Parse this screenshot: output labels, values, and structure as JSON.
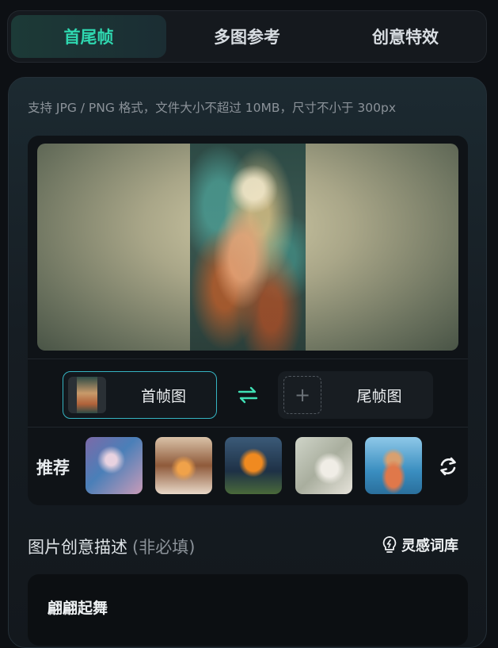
{
  "tabs": [
    {
      "label": "首尾帧",
      "active": true
    },
    {
      "label": "多图参考",
      "active": false
    },
    {
      "label": "创意特效",
      "active": false
    }
  ],
  "upload": {
    "hint": "支持 JPG / PNG 格式，文件大小不超过 10MB，尺寸不小于 300px",
    "first_frame_label": "首帧图",
    "last_frame_label": "尾帧图"
  },
  "recommend": {
    "label": "推荐",
    "items": [
      {
        "icon": "underwater-girl-thumbnail"
      },
      {
        "icon": "snow-cabin-thumbnail"
      },
      {
        "icon": "pumpkin-house-thumbnail"
      },
      {
        "icon": "girl-with-cat-thumbnail"
      },
      {
        "icon": "hamster-float-thumbnail"
      }
    ]
  },
  "description": {
    "title": "图片创意描述",
    "optional": "(非必填)",
    "library_label": "灵感词库",
    "value": "翩翩起舞"
  },
  "colors": {
    "accent": "#2fd8b0",
    "border_active": "#35b4c2"
  }
}
